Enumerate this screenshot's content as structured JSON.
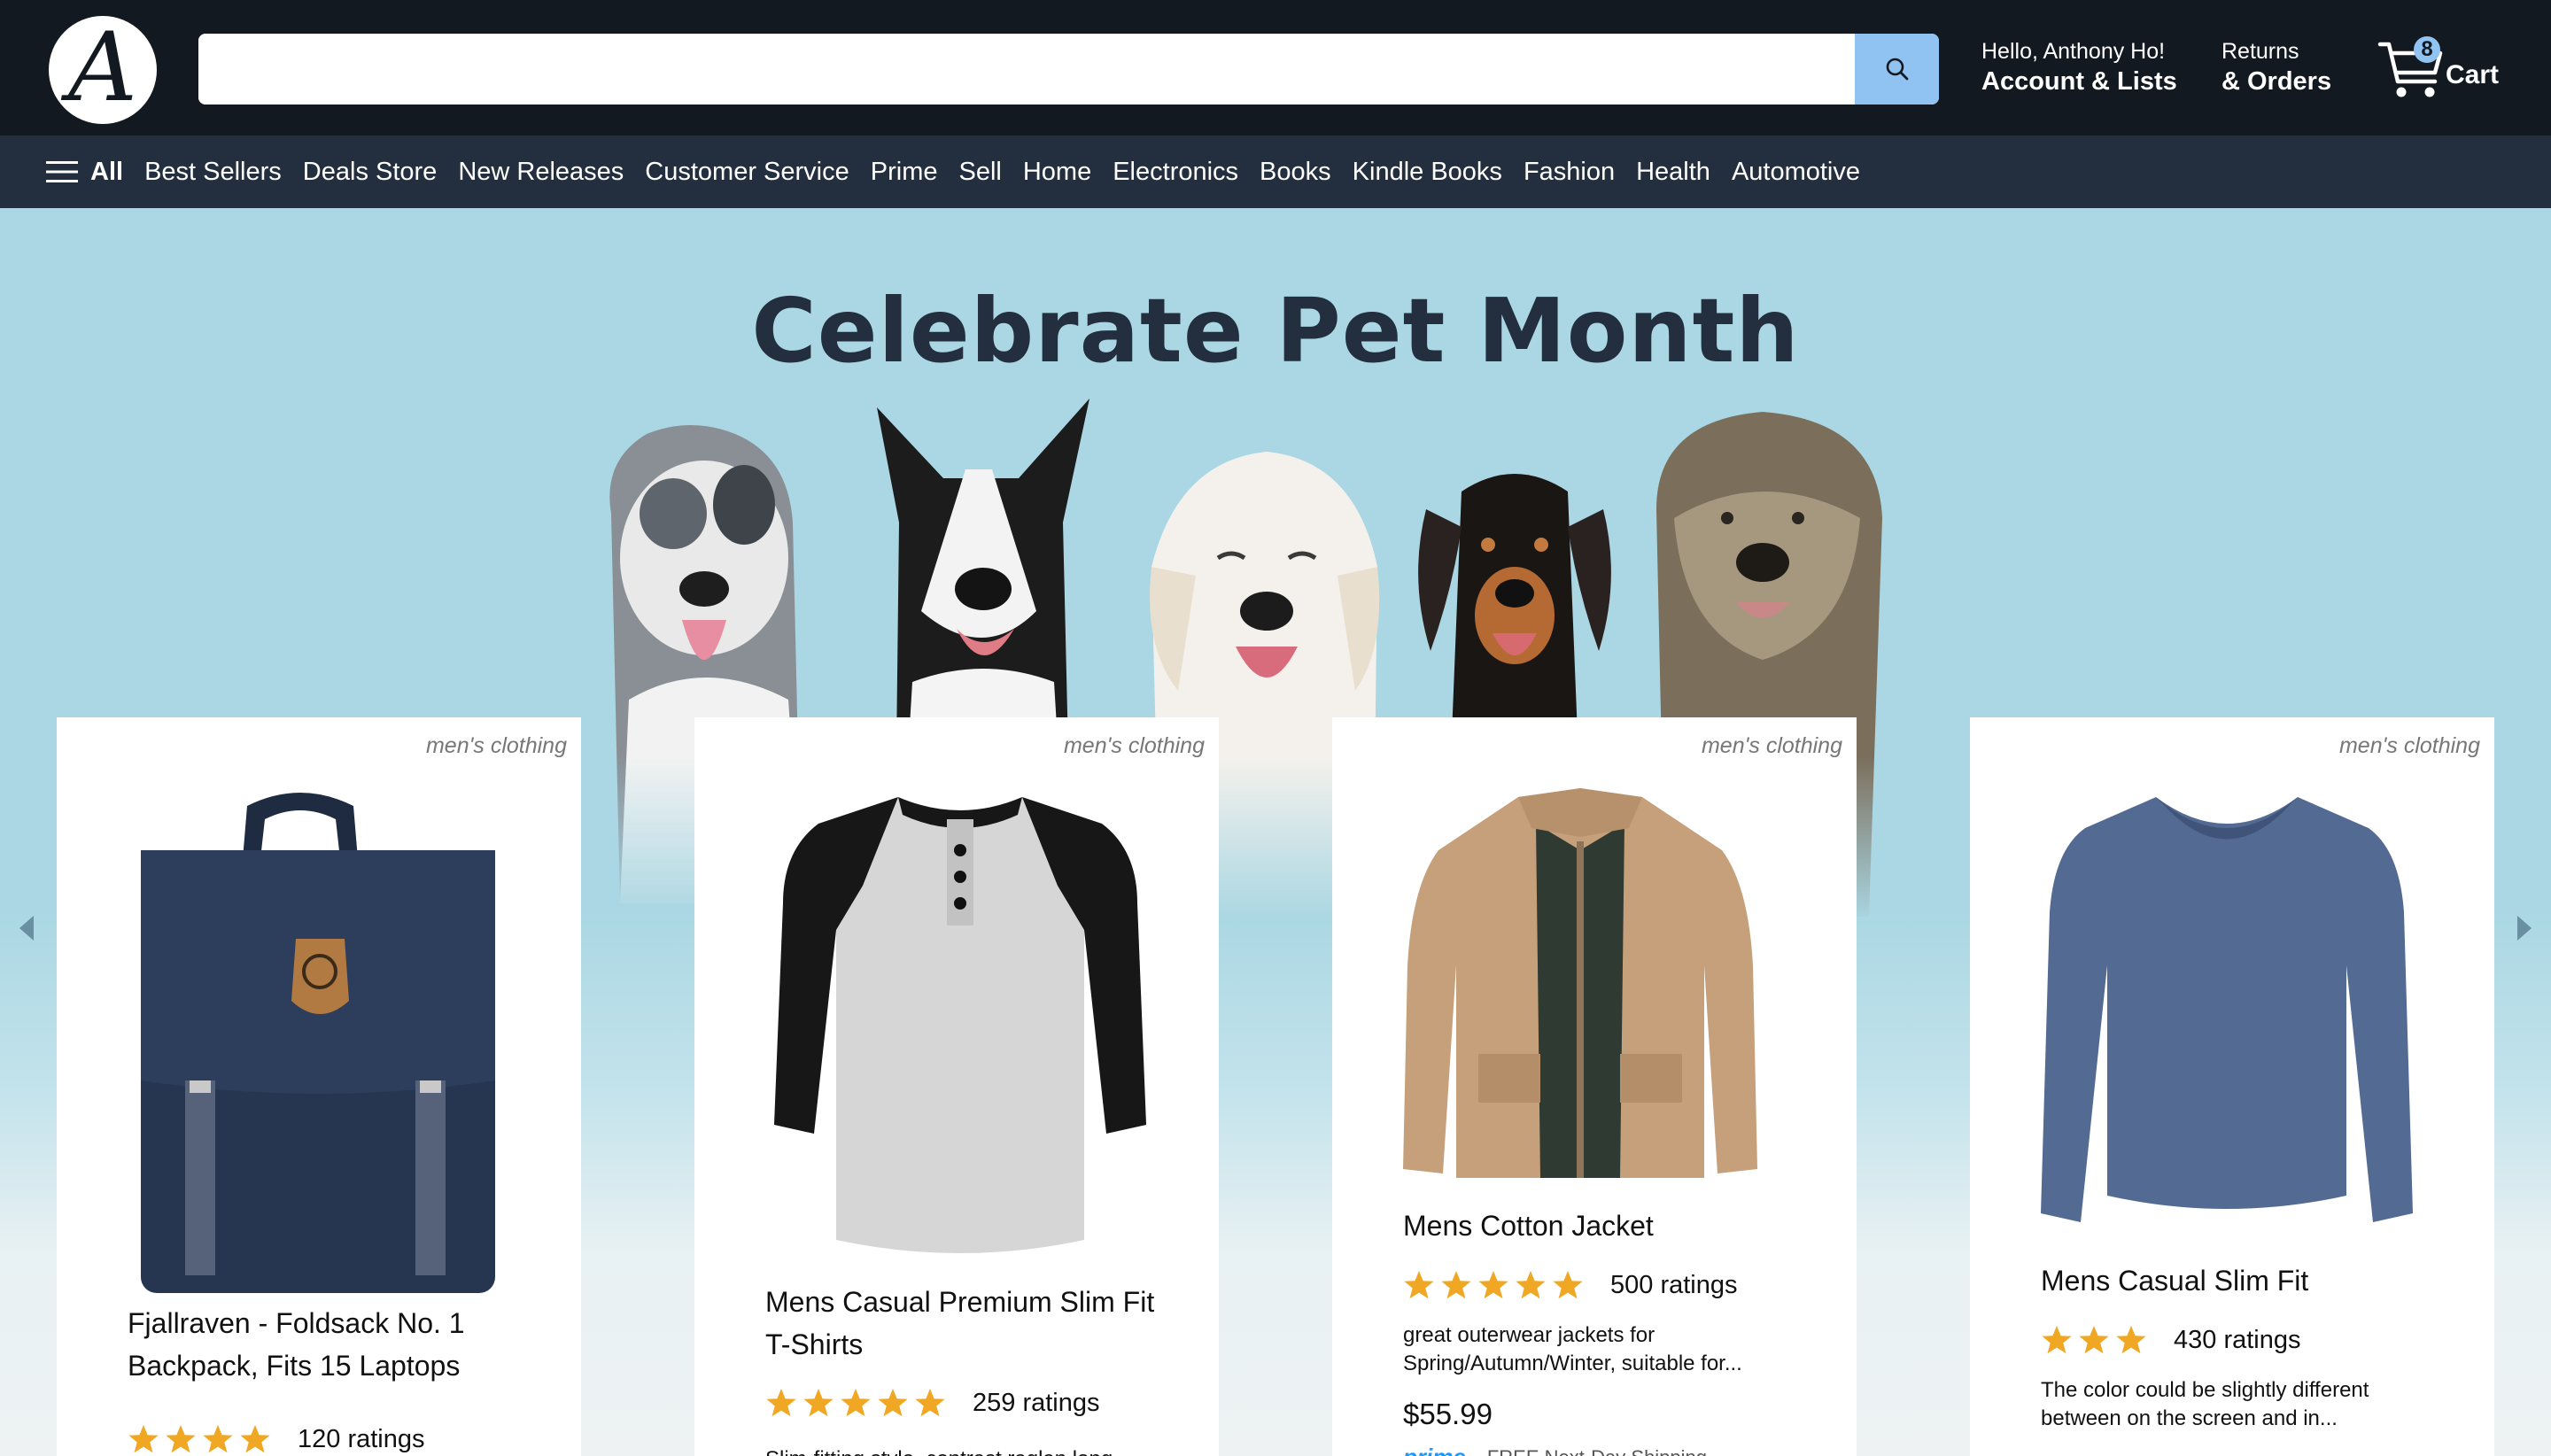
{
  "header": {
    "logo_letter": "A",
    "search": {
      "value": "",
      "placeholder": ""
    },
    "account": {
      "greeting": "Hello, Anthony Ho!",
      "label": "Account & Lists"
    },
    "returns": {
      "line1": "Returns",
      "line2": "& Orders"
    },
    "cart": {
      "count": "8",
      "label": "Cart"
    }
  },
  "nav": {
    "all_label": "All",
    "items": [
      "Best Sellers",
      "Deals Store",
      "New Releases",
      "Customer Service",
      "Prime",
      "Sell",
      "Home",
      "Electronics",
      "Books",
      "Kindle Books",
      "Fashion",
      "Health",
      "Automotive"
    ]
  },
  "hero": {
    "title": "Celebrate Pet Month"
  },
  "products": [
    {
      "category": "men's clothing",
      "title": "Fjallraven - Foldsack No. 1 Backpack, Fits 15 Laptops",
      "stars": 4,
      "ratings": "120 ratings"
    },
    {
      "category": "men's clothing",
      "title": "Mens Casual Premium Slim Fit T-Shirts",
      "stars": 5,
      "ratings": "259 ratings",
      "description": "Slim-fitting style, contrast raglan long"
    },
    {
      "category": "men's clothing",
      "title": "Mens Cotton Jacket",
      "stars": 5,
      "ratings": "500 ratings",
      "description": "great outerwear jackets for Spring/Autumn/Winter, suitable for...",
      "price": "$55.99",
      "prime": "prime",
      "shipping": "FREE Next-Day Shipping"
    },
    {
      "category": "men's clothing",
      "title": "Mens Casual Slim Fit",
      "stars": 3,
      "ratings": "430 ratings",
      "description": "The color could be slightly different between on the screen and in..."
    }
  ],
  "colors": {
    "header_bg": "#131921",
    "nav_bg": "#232f3e",
    "search_button": "#90c2f2",
    "star": "#f0a824",
    "hero_bg": "#aad7e3"
  }
}
